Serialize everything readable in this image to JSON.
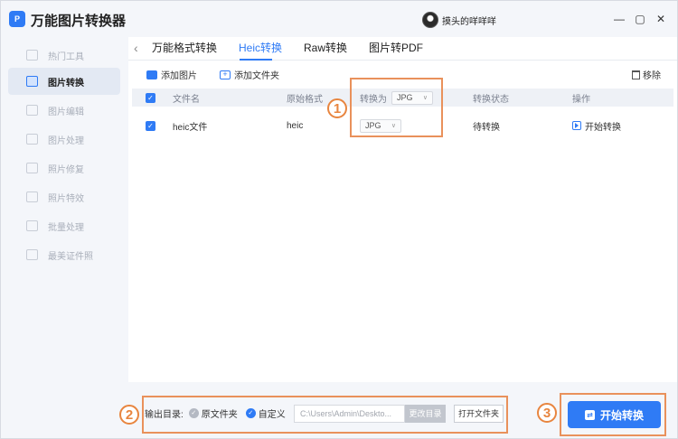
{
  "app": {
    "title": "万能图片转换器",
    "logo_text": "P",
    "user_name": "摸头的咩咩咩"
  },
  "window_controls": {
    "minimize": "—",
    "maximize": "▢",
    "close": "✕"
  },
  "sidebar": {
    "items": [
      {
        "label": "热门工具",
        "active": false
      },
      {
        "label": "图片转换",
        "active": true
      },
      {
        "label": "图片编辑",
        "active": false
      },
      {
        "label": "图片处理",
        "active": false
      },
      {
        "label": "照片修复",
        "active": false
      },
      {
        "label": "照片特效",
        "active": false
      },
      {
        "label": "批量处理",
        "active": false
      },
      {
        "label": "最美证件照",
        "active": false
      }
    ]
  },
  "tabs": {
    "back": "‹",
    "items": [
      {
        "label": "万能格式转换",
        "active": false
      },
      {
        "label": "Heic转换",
        "active": true
      },
      {
        "label": "Raw转换",
        "active": false
      },
      {
        "label": "图片转PDF",
        "active": false
      }
    ]
  },
  "toolbar": {
    "add_image": "添加图片",
    "add_folder": "添加文件夹",
    "remove": "移除"
  },
  "table": {
    "headers": {
      "name": "文件名",
      "orig_format": "原始格式",
      "convert_to": "转换为",
      "convert_to_value": "JPG",
      "status": "转换状态",
      "action": "操作"
    },
    "rows": [
      {
        "name": "heic文件",
        "orig_format": "heic",
        "format": "JPG",
        "status": "待转换",
        "action": "开始转换"
      }
    ]
  },
  "bottom": {
    "output_label": "输出目录:",
    "opt_source": "原文件夹",
    "opt_custom": "自定义",
    "path": "C:\\Users\\Admin\\Deskto...",
    "change_dir": "更改目录",
    "open_folder": "打开文件夹",
    "start": "开始转换"
  },
  "annotations": {
    "n1": "1",
    "n2": "2",
    "n3": "3"
  },
  "colors": {
    "accent": "#2f7bf5",
    "annotation": "#e8853f"
  }
}
